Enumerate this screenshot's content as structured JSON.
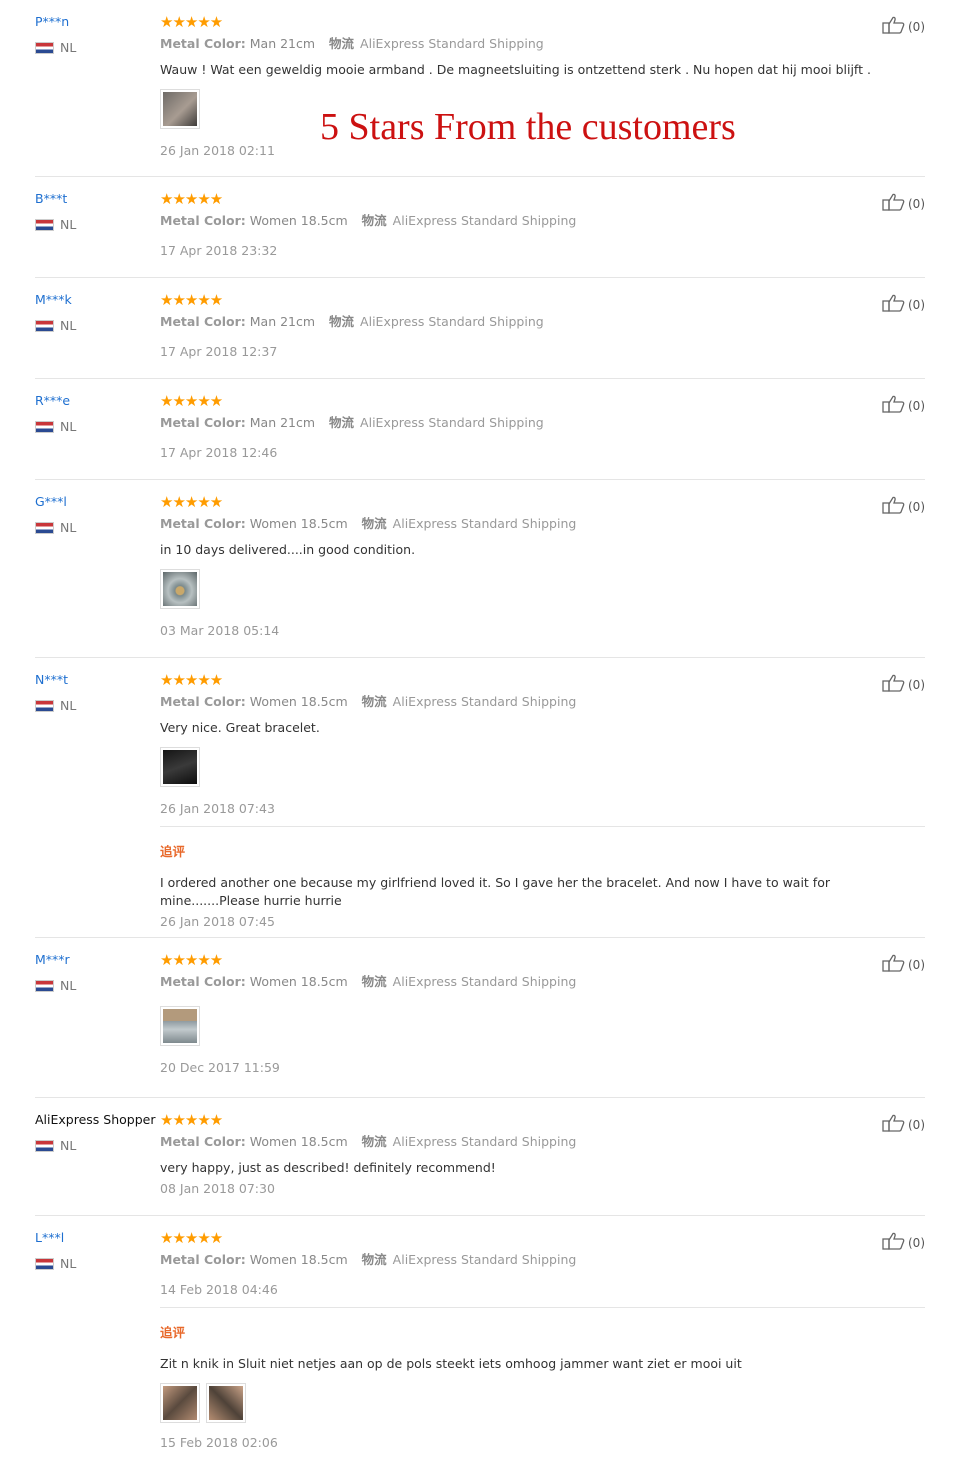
{
  "banner": "5 Stars From the customers",
  "labels": {
    "metal_color": "Metal Color:",
    "shipping_label": "物流",
    "follow_up": "追评"
  },
  "colors": {
    "star": "#ff9c00",
    "username": "#1e6fd0",
    "banner": "#cc1111",
    "follow_up": "#e8692b"
  },
  "reviews": [
    {
      "user": "P***n",
      "country": "NL",
      "stars": "★★★★★",
      "metal_color": "Man 21cm",
      "shipping": "AliExpress Standard Shipping",
      "text": "Wauw ! Wat een geweldig mooie armband . De magneetsluiting is ontzettend sterk . Nu hopen dat hij mooi blijft .",
      "date": "26 Jan 2018 02:11",
      "likes": "(0)"
    },
    {
      "user": "B***t",
      "country": "NL",
      "stars": "★★★★★",
      "metal_color": "Women 18.5cm",
      "shipping": "AliExpress Standard Shipping",
      "date": "17 Apr 2018 23:32",
      "likes": "(0)"
    },
    {
      "user": "M***k",
      "country": "NL",
      "stars": "★★★★★",
      "metal_color": "Man 21cm",
      "shipping": "AliExpress Standard Shipping",
      "date": "17 Apr 2018 12:37",
      "likes": "(0)"
    },
    {
      "user": "R***e",
      "country": "NL",
      "stars": "★★★★★",
      "metal_color": "Man 21cm",
      "shipping": "AliExpress Standard Shipping",
      "date": "17 Apr 2018 12:46",
      "likes": "(0)"
    },
    {
      "user": "G***l",
      "country": "NL",
      "stars": "★★★★★",
      "metal_color": "Women 18.5cm",
      "shipping": "AliExpress Standard Shipping",
      "text": "in 10 days delivered....in good condition.",
      "date": "03 Mar 2018 05:14",
      "likes": "(0)"
    },
    {
      "user": "N***t",
      "country": "NL",
      "stars": "★★★★★",
      "metal_color": "Women 18.5cm",
      "shipping": "AliExpress Standard Shipping",
      "text": "Very nice. Great bracelet.",
      "date": "26 Jan 2018 07:43",
      "likes": "(0)",
      "followup_text": "I ordered another one because my girlfriend loved it. So I gave her the bracelet. And now I have to wait for mine.......Please hurrie hurrie",
      "followup_date": "26 Jan 2018 07:45"
    },
    {
      "user": "M***r",
      "country": "NL",
      "stars": "★★★★★",
      "metal_color": "Women 18.5cm",
      "shipping": "AliExpress Standard Shipping",
      "date": "20 Dec 2017 11:59",
      "likes": "(0)"
    },
    {
      "user": "AliExpress Shopper",
      "country": "NL",
      "stars": "★★★★★",
      "metal_color": "Women 18.5cm",
      "shipping": "AliExpress Standard Shipping",
      "text": "very happy, just as described! definitely recommend!",
      "date": "08 Jan 2018 07:30",
      "likes": "(0)"
    },
    {
      "user": "L***l",
      "country": "NL",
      "stars": "★★★★★",
      "metal_color": "Women 18.5cm",
      "shipping": "AliExpress Standard Shipping",
      "date": "14 Feb 2018 04:46",
      "likes": "(0)",
      "followup_text": "Zit n knik in Sluit niet netjes aan op de pols steekt iets omhoog jammer want ziet er mooi uit",
      "followup_date": "15 Feb 2018 02:06"
    }
  ]
}
